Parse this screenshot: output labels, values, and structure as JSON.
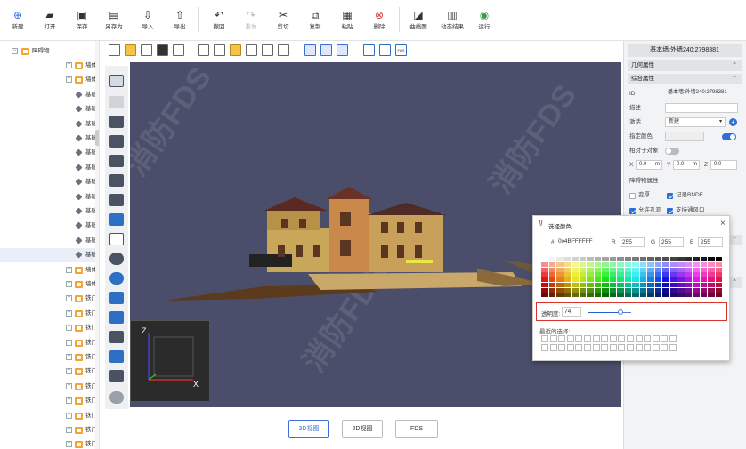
{
  "toolbar": {
    "new": "新建",
    "open": "打开",
    "save": "保存",
    "save_as": "另存为",
    "import": "导入",
    "export": "导出",
    "undo": "撤回",
    "redo": "重做",
    "cut": "剪切",
    "copy": "复制",
    "paste": "粘贴",
    "delete": "删除",
    "curve": "曲线图",
    "dynamic": "动态结果",
    "run": "运行"
  },
  "tree": {
    "root": "障碍物",
    "items": [
      "墙体",
      "墙体",
      "基础",
      "基础",
      "基础",
      "基础",
      "基础",
      "基础",
      "基础",
      "基础",
      "基础",
      "基础",
      "基础",
      "基础",
      "墙体",
      "墙体",
      "铁门",
      "铁门",
      "铁门",
      "铁门",
      "铁门",
      "铁门",
      "铁门",
      "铁门",
      "铁门",
      "铁门",
      "铁门",
      "铁门"
    ]
  },
  "viewport": {
    "watermark": "消防FDS"
  },
  "axes": {
    "z": "Z",
    "x": "X"
  },
  "view_tabs": {
    "v3d": "3D视图",
    "v2d": "2D视图",
    "fds": "FDS"
  },
  "props": {
    "title": "基本墙:外墙240:2798381",
    "geom_section": "几何属性",
    "general_section": "综合属性",
    "id_label": "ID",
    "id_value": "基本墙:外墙240:2798381",
    "desc_label": "描述",
    "activate_label": "激活",
    "activate_value": "新建",
    "color_label": "指定颜色",
    "relative_label": "相对于对象",
    "x_label": "X",
    "x_value": "0.0",
    "x_unit": "m",
    "y_label": "Y",
    "y_value": "0.0",
    "y_unit": "m",
    "z_label": "Z",
    "z_value": "0.0",
    "obstacle_section": "障碍物属性",
    "thicken": "变厚",
    "record_bndf": "记录BNDF",
    "allow_holes": "允许孔洞",
    "support_vent": "支持通风口"
  },
  "color_dialog": {
    "title": "选择颜色",
    "hex_label": "#",
    "hex_value": "0x4BFFFFFF",
    "r_label": "R",
    "r_value": "255",
    "g_label": "G",
    "g_value": "255",
    "b_label": "B",
    "b_value": "255",
    "opacity_label": "透明度:",
    "opacity_value": "74",
    "opacity_fraction": 0.74,
    "recent_label": "最近的选择:"
  },
  "colors": {
    "accent": "#3d6fd8",
    "viewport_bg": "#4b4e6a",
    "highlight": "#d9342b"
  }
}
